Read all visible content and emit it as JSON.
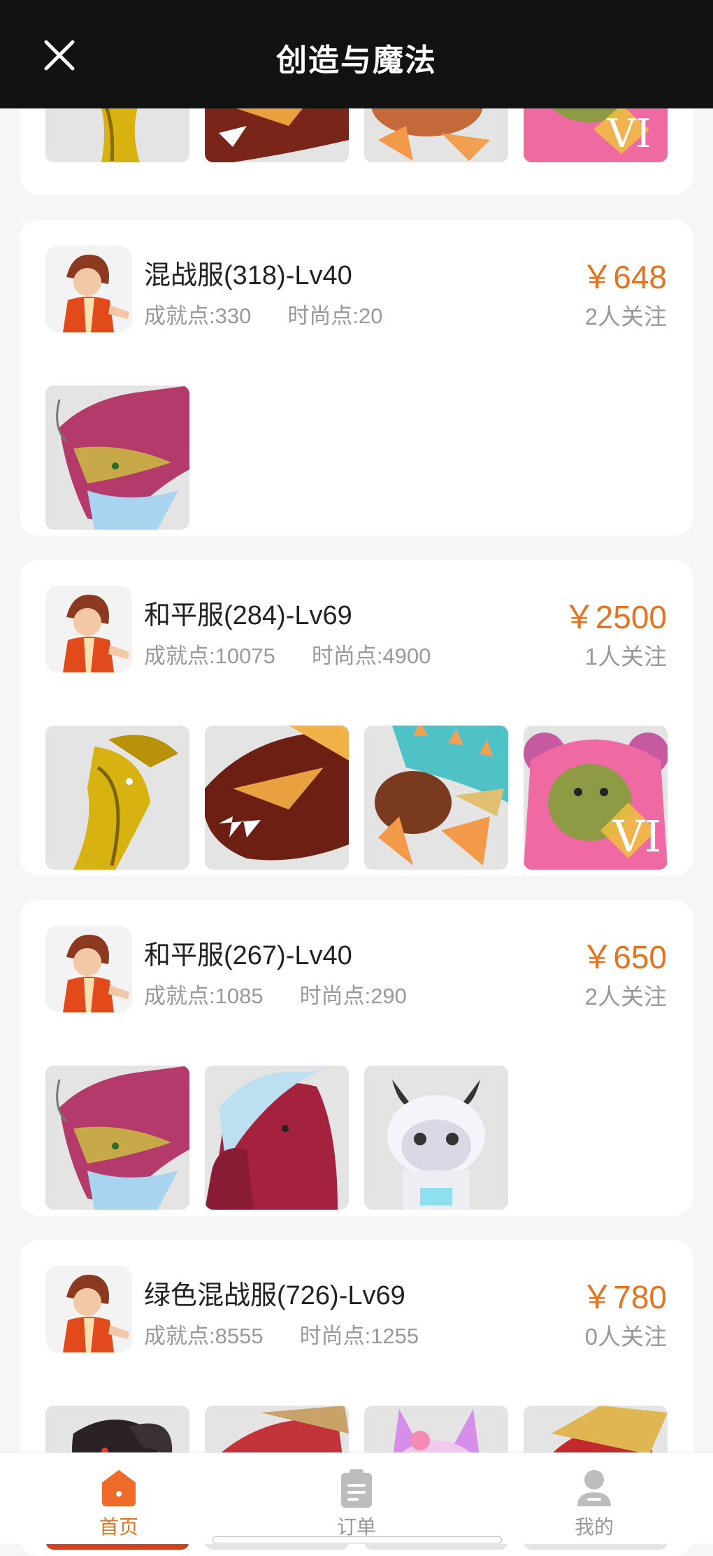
{
  "header": {
    "title": "创造与魔法",
    "close_icon": "close-icon"
  },
  "listings": [
    {
      "name": "混战服(318)-Lv40",
      "achievement": "成就点:330",
      "fashion": "时尚点:20",
      "price": "￥648",
      "followers": "2人关注",
      "items": [
        "pink-dragon"
      ]
    },
    {
      "name": "和平服(284)-Lv69",
      "achievement": "成就点:10075",
      "fashion": "时尚点:4900",
      "price": "￥2500",
      "followers": "1人关注",
      "items": [
        "gold-dragon",
        "red-dragon",
        "blue-spiked-beast",
        "pink-bear-vi"
      ]
    },
    {
      "name": "和平服(267)-Lv40",
      "achievement": "成就点:1085",
      "fashion": "时尚点:290",
      "price": "￥650",
      "followers": "2人关注",
      "items": [
        "pink-dragon",
        "crimson-horse",
        "white-cow-robot"
      ]
    },
    {
      "name": "绿色混战服(726)-Lv69",
      "achievement": "成就点:8555",
      "fashion": "时尚点:1255",
      "price": "￥780",
      "followers": "0人关注",
      "items": [
        "black-ram",
        "red-dragon",
        "pink-fox",
        "gold-red-dragon"
      ]
    }
  ],
  "tabbar": {
    "home": "首页",
    "orders": "订单",
    "mine": "我的"
  },
  "colors": {
    "accent": "#e8731f",
    "header": "#121212"
  }
}
